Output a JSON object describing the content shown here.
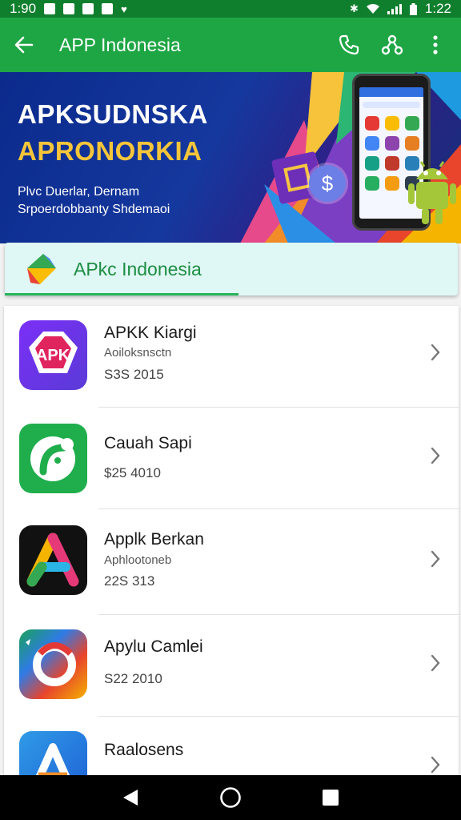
{
  "status_bar": {
    "time_left": "1:90",
    "time_right": "1:22"
  },
  "app_bar": {
    "back_icon": "arrow-left-icon",
    "title": "APP Indonesia",
    "actions": [
      "phone-icon",
      "share-icon",
      "more-vert-icon"
    ]
  },
  "banner": {
    "title_line1": "APKSUDNSKA",
    "title_line2": "APRONORKIA",
    "subtitle_line1": "Plvc Duerlar, Dernam",
    "subtitle_line2": "Srpoerdobbanty Shdemaoi",
    "colors": {
      "title1": "#ffffff",
      "title2": "#f6c53a",
      "background": "#15389e"
    }
  },
  "section": {
    "label": "APkc Indonesia",
    "accent": "#1d8e43"
  },
  "apps": [
    {
      "name": "APKK Kiargi",
      "subtitle": "Aoiloksnsctn",
      "meta": "S3S 2015",
      "icon": "apk-shield-icon"
    },
    {
      "name": "Cauah Sapi",
      "subtitle": "",
      "meta": "$25 4010",
      "icon": "green-runner-icon"
    },
    {
      "name": "Applk Berkan",
      "subtitle": "Aphlootoneb",
      "meta": "22S 313",
      "icon": "colorful-a-icon"
    },
    {
      "name": "Apylu Camlei",
      "subtitle": "",
      "meta": "S22 2010",
      "icon": "swirl-icon"
    },
    {
      "name": "Raalosens",
      "subtitle": "",
      "meta": "",
      "icon": "blue-a-icon"
    }
  ],
  "nav": [
    "back-triangle-icon",
    "home-circle-icon",
    "recents-square-icon"
  ],
  "theme": {
    "status_bar": "#0f7f2e",
    "app_bar": "#1ea644"
  }
}
